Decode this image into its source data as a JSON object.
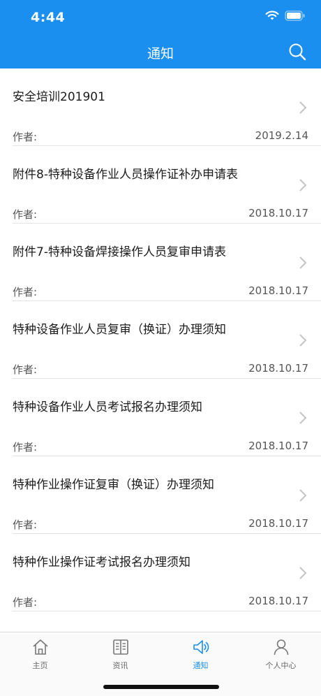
{
  "status_bar": {
    "time": "4:44"
  },
  "header": {
    "title": "通知"
  },
  "notices": [
    {
      "title": "安全培训201901",
      "author_label": "作者:",
      "date": "2019.2.14"
    },
    {
      "title": "附件8-特种设备作业人员操作证补办申请表",
      "author_label": "作者:",
      "date": "2018.10.17"
    },
    {
      "title": "附件7-特种设备焊接操作人员复审申请表",
      "author_label": "作者:",
      "date": "2018.10.17"
    },
    {
      "title": "特种设备作业人员复审（换证）办理须知",
      "author_label": "作者:",
      "date": "2018.10.17"
    },
    {
      "title": "特种设备作业人员考试报名办理须知",
      "author_label": "作者:",
      "date": "2018.10.17"
    },
    {
      "title": "特种作业操作证复审（换证）办理须知",
      "author_label": "作者:",
      "date": "2018.10.17"
    },
    {
      "title": "特种作业操作证考试报名办理须知",
      "author_label": "作者:",
      "date": "2018.10.17"
    }
  ],
  "tabbar": {
    "tabs": [
      {
        "label": "主页",
        "icon": "home-icon"
      },
      {
        "label": "资讯",
        "icon": "book-icon"
      },
      {
        "label": "通知",
        "icon": "speaker-icon"
      },
      {
        "label": "个人中心",
        "icon": "user-icon"
      }
    ],
    "active_index": 2
  },
  "colors": {
    "primary": "#1a8ff0",
    "divider": "#e4e4e4",
    "text": "#1c1c1c"
  }
}
